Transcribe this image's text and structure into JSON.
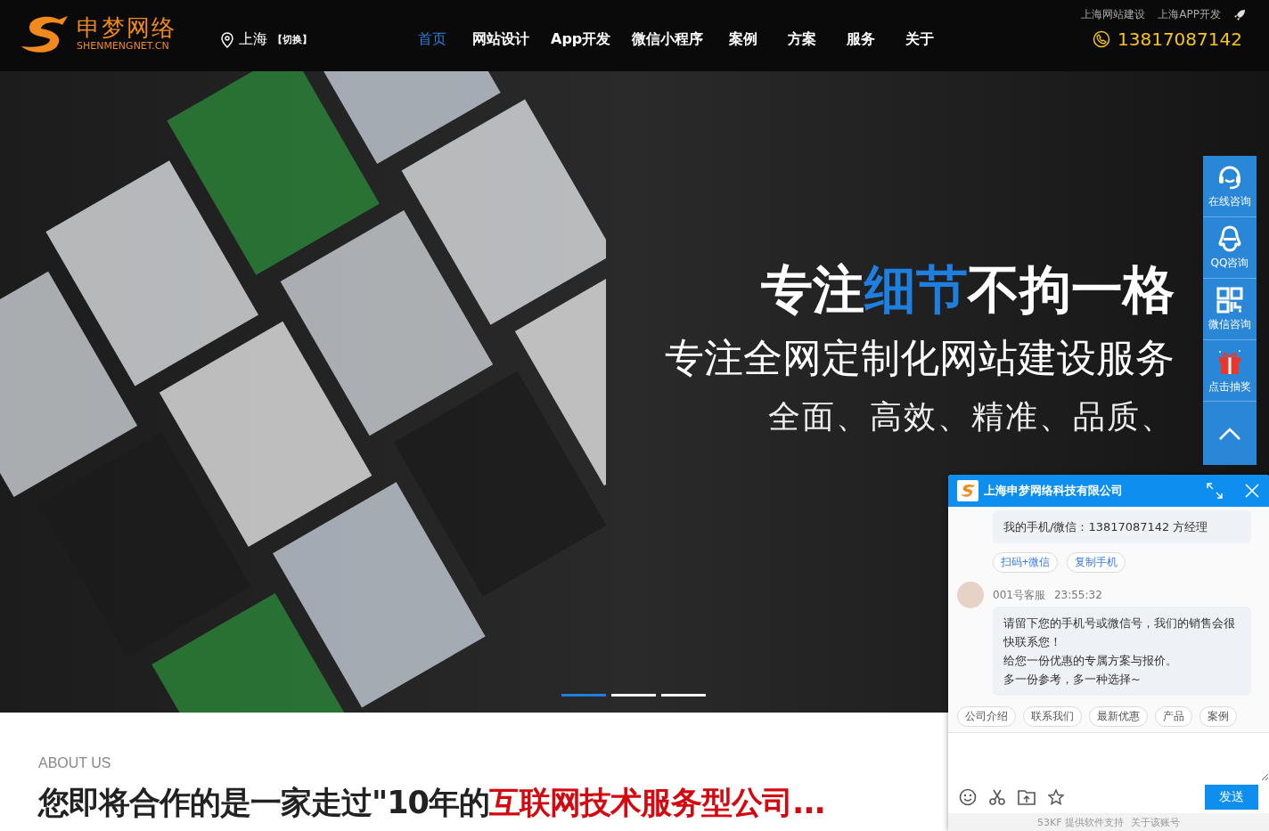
{
  "header": {
    "logo": {
      "name": "申梦网络",
      "domain": "SHENMENGNET.CN"
    },
    "city": "上海",
    "city_switch": "【切换】",
    "nav": [
      {
        "label": "首页",
        "selected": true
      },
      {
        "label": "网站设计",
        "selected": false
      },
      {
        "label": "App开发",
        "selected": false
      },
      {
        "label": "微信小程序",
        "selected": false
      },
      {
        "label": "案例",
        "selected": false
      },
      {
        "label": "方案",
        "selected": false
      },
      {
        "label": "服务",
        "selected": false
      },
      {
        "label": "关于",
        "selected": false
      }
    ],
    "top_links": [
      "上海网站建设",
      "上海APP开发"
    ],
    "phone": "13817087142"
  },
  "hero": {
    "headline": [
      {
        "text": "专注",
        "highlight": false
      },
      {
        "text": "细节",
        "highlight": true
      },
      {
        "text": "不拘一格",
        "highlight": false
      }
    ],
    "subtitle": "专注全网定制化网站建设服务",
    "tagline": "全面、高效、精准、品质、",
    "slides": [
      {
        "selected": true
      },
      {
        "selected": false
      },
      {
        "selected": false
      }
    ]
  },
  "float_bar": {
    "items": [
      {
        "kind": "headset",
        "label": "在线咨询"
      },
      {
        "kind": "qq",
        "label": "QQ咨询"
      },
      {
        "kind": "qr",
        "label": "微信咨询"
      },
      {
        "kind": "gift",
        "label": "点击抽奖"
      },
      {
        "kind": "top"
      }
    ]
  },
  "chat": {
    "title": "上海申梦网络科技有限公司",
    "contact_message": "我的手机/微信：13817087142 方经理",
    "contact_actions": [
      "扫码+微信",
      "复制手机"
    ],
    "agent": "001号客服",
    "time": "23:55:32",
    "message_lines": [
      "请留下您的手机号或微信号，我们的销售会很快联系您！",
      "给您一份优惠的专属方案与报价。",
      "多一份参考，多一种选择~"
    ],
    "quick_replies": [
      "公司介绍",
      "联系我们",
      "最新优惠",
      "产品",
      "案例"
    ],
    "send": "发送",
    "footer": [
      "53KF 提供软件支持",
      "关于该账号"
    ]
  },
  "about": {
    "eyebrow": "ABOUT US",
    "heading": [
      {
        "text": "您即将合作的是一家走过\"10年的",
        "highlight": false
      },
      {
        "text": "互联网技术服务型公司...",
        "highlight": true
      }
    ]
  }
}
